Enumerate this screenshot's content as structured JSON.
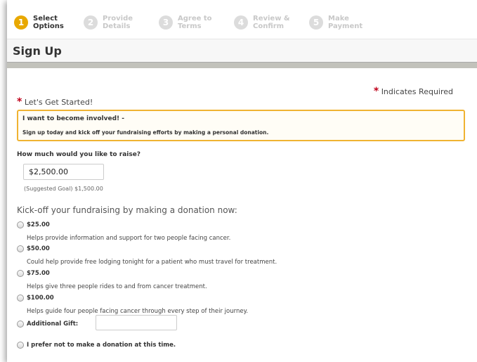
{
  "steps": [
    {
      "number": "1",
      "line1": "Select",
      "line2": "Options"
    },
    {
      "number": "2",
      "line1": "Provide",
      "line2": "Details"
    },
    {
      "number": "3",
      "line1": "Agree to",
      "line2": "Terms"
    },
    {
      "number": "4",
      "line1": "Review &",
      "line2": "Confirm"
    },
    {
      "number": "5",
      "line1": "Make",
      "line2": "Payment"
    }
  ],
  "page_title": "Sign Up",
  "required_note": "Indicates Required",
  "required_star": "*",
  "start_label": "Let's Get Started!",
  "callout": {
    "heading": "I want to become involved! -",
    "body": "Sign up today and kick off your fundraising efforts by making a personal donation."
  },
  "raise": {
    "label": "How much would you like to raise?",
    "value": "$2,500.00",
    "suggested": "(Suggested Goal) $1,500.00"
  },
  "donation": {
    "heading": "Kick-off your fundraising by making a donation now:",
    "options": [
      {
        "amount": "$25.00",
        "description": "Helps provide information and support for two people facing cancer."
      },
      {
        "amount": "$50.00",
        "description": "Could help provide free lodging tonight for a patient who must travel for treatment."
      },
      {
        "amount": "$75.00",
        "description": "Helps give three people rides to and from cancer treatment."
      },
      {
        "amount": "$100.00",
        "description": "Helps guide four people facing cancer through every step of their journey."
      }
    ],
    "additional_label": "Additional Gift:",
    "additional_value": "",
    "decline_label": "I prefer not to make a donation at this time."
  },
  "colors": {
    "accent": "#e8a800",
    "required": "#c0001a",
    "callout_border": "#f0b332"
  }
}
